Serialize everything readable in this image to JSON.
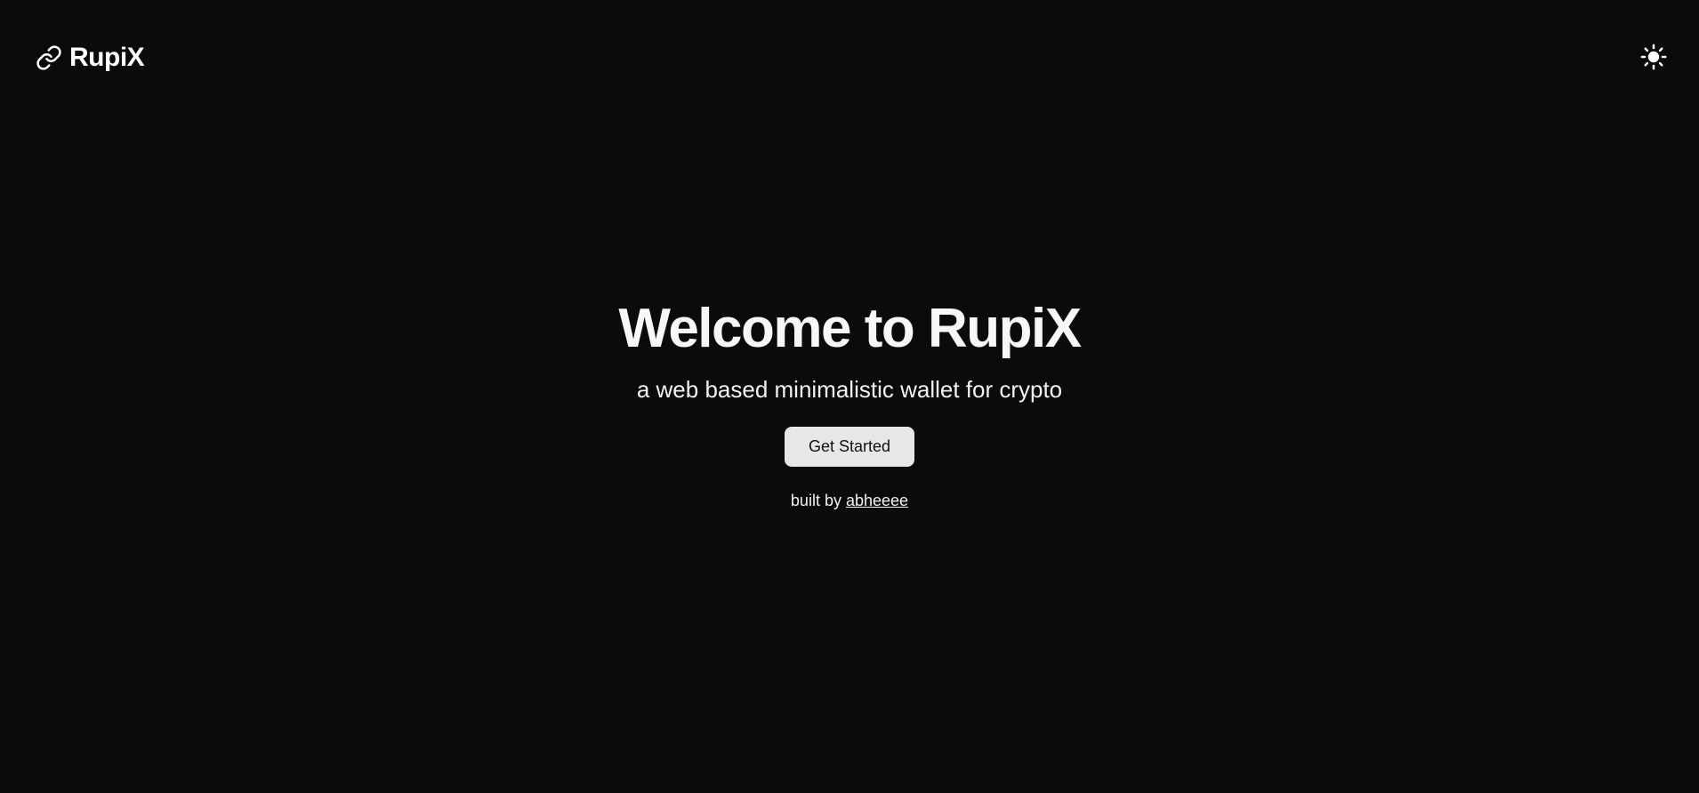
{
  "header": {
    "brand_name": "RupiX",
    "brand_icon": "link-icon",
    "theme_toggle_icon": "sun-icon"
  },
  "hero": {
    "title": "Welcome to RupiX",
    "subtitle": "a web based minimalistic wallet for crypto",
    "cta_label": "Get Started",
    "credit_prefix": "built by",
    "credit_author": "abheeee"
  },
  "colors": {
    "background": "#0b0b0b",
    "text": "#f5f5f5",
    "button_bg": "#e7e7e7",
    "button_text": "#111111"
  }
}
